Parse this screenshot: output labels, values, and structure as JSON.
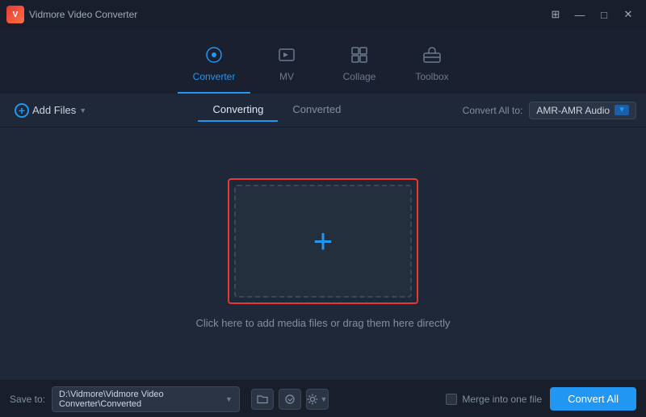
{
  "titleBar": {
    "appName": "Vidmore Video Converter",
    "controls": {
      "minimize": "—",
      "maximize": "□",
      "close": "✕",
      "chat": "⊞"
    }
  },
  "nav": {
    "tabs": [
      {
        "id": "converter",
        "label": "Converter",
        "icon": "⊙",
        "active": true
      },
      {
        "id": "mv",
        "label": "MV",
        "icon": "🖼"
      },
      {
        "id": "collage",
        "label": "Collage",
        "icon": "⊞"
      },
      {
        "id": "toolbox",
        "label": "Toolbox",
        "icon": "🧰"
      }
    ]
  },
  "toolbar": {
    "addFilesLabel": "Add Files",
    "subTabs": [
      {
        "id": "converting",
        "label": "Converting",
        "active": true
      },
      {
        "id": "converted",
        "label": "Converted",
        "active": false
      }
    ],
    "convertAllLabel": "Convert All to:",
    "formatLabel": "AMR-AMR Audio"
  },
  "mainContent": {
    "dropHint": "Click here to add media files or drag them here directly"
  },
  "footer": {
    "saveToLabel": "Save to:",
    "savePath": "D:\\Vidmore\\Vidmore Video Converter\\Converted",
    "mergeLabel": "Merge into one file",
    "convertAllBtn": "Convert All"
  }
}
